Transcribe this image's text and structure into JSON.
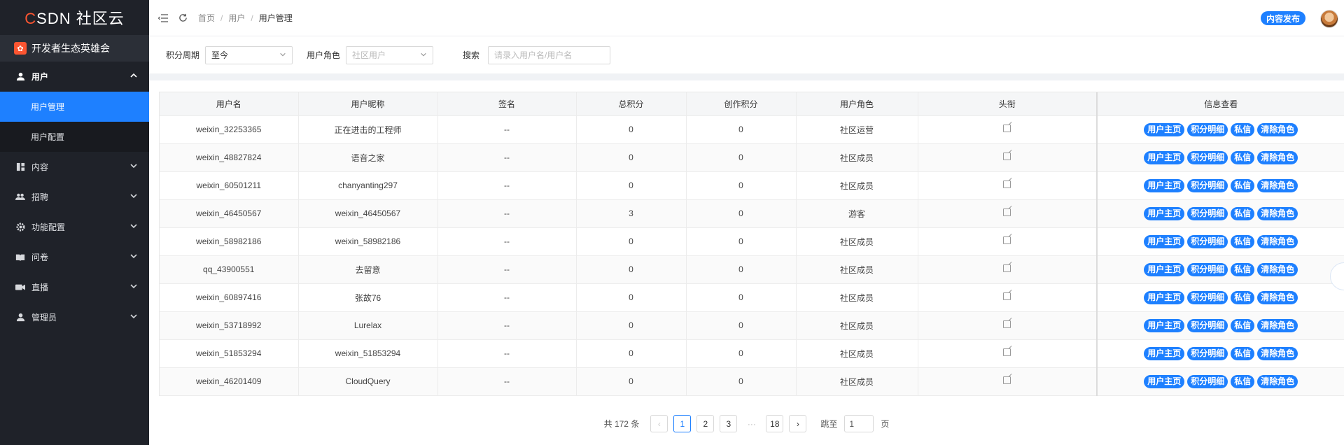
{
  "logo": {
    "c": "C",
    "rest": "SDN",
    "suffix": "社区云"
  },
  "org": {
    "name": "开发者生态英雄会",
    "icon": "flower-icon"
  },
  "sidebar": {
    "items": [
      {
        "label": "用户",
        "icon": "user-icon",
        "open": true,
        "children": [
          {
            "label": "用户管理",
            "active": true
          },
          {
            "label": "用户配置"
          }
        ]
      },
      {
        "label": "内容",
        "icon": "content-icon"
      },
      {
        "label": "招聘",
        "icon": "recruit-icon"
      },
      {
        "label": "功能配置",
        "icon": "gear-icon"
      },
      {
        "label": "问卷",
        "icon": "book-icon"
      },
      {
        "label": "直播",
        "icon": "video-icon"
      },
      {
        "label": "管理员",
        "icon": "user-icon"
      }
    ]
  },
  "header": {
    "breadcrumb": [
      "首页",
      "用户",
      "用户管理"
    ],
    "publish_label": "内容发布"
  },
  "filters": {
    "period_label": "积分周期",
    "period_value": "至今",
    "role_label": "用户角色",
    "role_placeholder": "社区用户",
    "search_label": "搜索",
    "search_placeholder": "请录入用户名/用户名"
  },
  "table": {
    "columns": [
      "用户名",
      "用户昵称",
      "签名",
      "总积分",
      "创作积分",
      "用户角色",
      "头衔",
      "信息查看"
    ],
    "actions": [
      "用户主页",
      "积分明细",
      "私信",
      "清除角色"
    ],
    "rows": [
      {
        "username": "weixin_32253365",
        "nickname": "正在进击的工程师",
        "signature": "--",
        "total": "0",
        "creation": "0",
        "role": "社区运营"
      },
      {
        "username": "weixin_48827824",
        "nickname": "语音之家",
        "signature": "--",
        "total": "0",
        "creation": "0",
        "role": "社区成员"
      },
      {
        "username": "weixin_60501211",
        "nickname": "chanyanting297",
        "signature": "--",
        "total": "0",
        "creation": "0",
        "role": "社区成员"
      },
      {
        "username": "weixin_46450567",
        "nickname": "weixin_46450567",
        "signature": "--",
        "total": "3",
        "creation": "0",
        "role": "游客"
      },
      {
        "username": "weixin_58982186",
        "nickname": "weixin_58982186",
        "signature": "--",
        "total": "0",
        "creation": "0",
        "role": "社区成员"
      },
      {
        "username": "qq_43900551",
        "nickname": "去留意",
        "signature": "--",
        "total": "0",
        "creation": "0",
        "role": "社区成员"
      },
      {
        "username": "weixin_60897416",
        "nickname": "张故76",
        "signature": "--",
        "total": "0",
        "creation": "0",
        "role": "社区成员"
      },
      {
        "username": "weixin_53718992",
        "nickname": "Lurelax",
        "signature": "--",
        "total": "0",
        "creation": "0",
        "role": "社区成员"
      },
      {
        "username": "weixin_51853294",
        "nickname": "weixin_51853294",
        "signature": "--",
        "total": "0",
        "creation": "0",
        "role": "社区成员"
      },
      {
        "username": "weixin_46201409",
        "nickname": "CloudQuery",
        "signature": "--",
        "total": "0",
        "creation": "0",
        "role": "社区成员"
      }
    ]
  },
  "pagination": {
    "total_text": "共 172 条",
    "prev": "‹",
    "next": "›",
    "pages": [
      "1",
      "2",
      "3"
    ],
    "dots": "···",
    "last": "18",
    "current": "1",
    "jump_prefix": "跳至",
    "jump_value": "1",
    "jump_suffix": "页"
  }
}
